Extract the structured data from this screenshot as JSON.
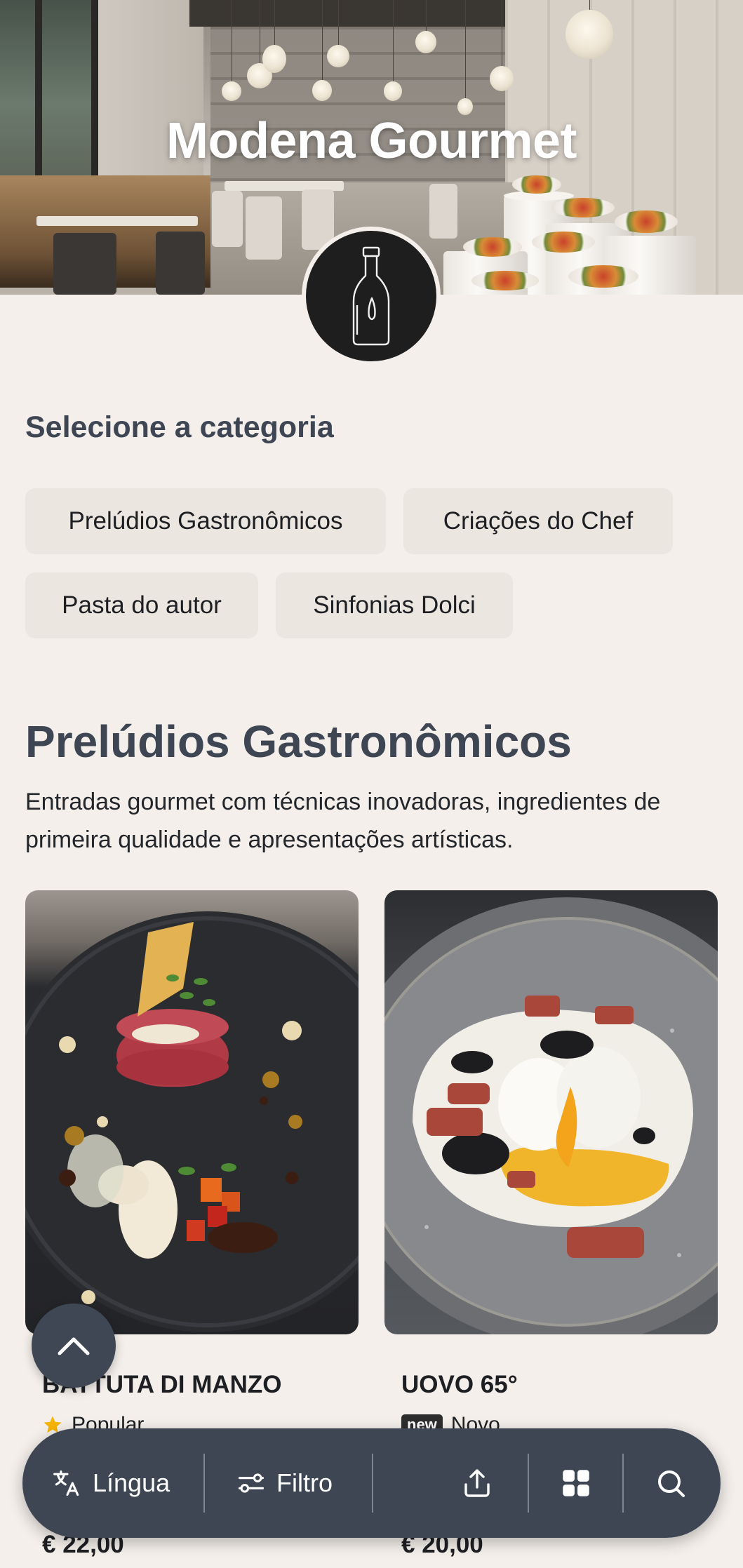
{
  "header": {
    "restaurant_name": "Modena Gourmet",
    "logo_icon": "wine-bottle-icon"
  },
  "categories": {
    "heading": "Selecione a categoria",
    "items": [
      {
        "label": "Prelúdios Gastronômicos"
      },
      {
        "label": "Criações do Chef"
      },
      {
        "label": "Pasta do autor"
      },
      {
        "label": "Sinfonias Dolci"
      }
    ]
  },
  "section": {
    "title": "Prelúdios Gastronômicos",
    "description": "Entradas gourmet com técnicas inovadoras, ingredientes de primeira qualidade e apresentações artísticas."
  },
  "dishes": [
    {
      "name": "BATTUTA DI MANZO",
      "tag": "Popular",
      "tag_icon": "star-icon",
      "price": "€ 22,00"
    },
    {
      "name": "UOVO 65°",
      "tag": "Novo",
      "badge": "new",
      "price": "€ 20,00"
    }
  ],
  "bottom_bar": {
    "language_label": "Língua",
    "filter_label": "Filtro",
    "icons": [
      "translate-icon",
      "filter-icon",
      "share-icon",
      "grid-icon",
      "search-icon"
    ]
  },
  "colors": {
    "background": "#f4efeb",
    "chip": "#ece6e1",
    "heading": "#3e4654",
    "bar": "#3d4652",
    "star": "#f5b400"
  }
}
